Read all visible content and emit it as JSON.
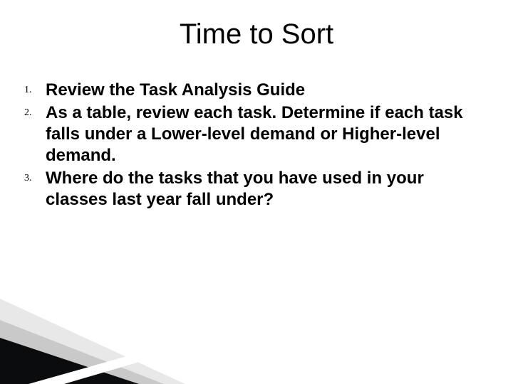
{
  "slide": {
    "title": "Time to Sort",
    "items": [
      {
        "num": "1.",
        "text": "Review the Task Analysis Guide"
      },
      {
        "num": "2.",
        "text": "As a table, review each task. Determine if each task falls under a Lower-level demand or Higher-level demand."
      },
      {
        "num": "3.",
        "text": "Where do the tasks that you have used in your classes last year fall under?"
      }
    ]
  }
}
